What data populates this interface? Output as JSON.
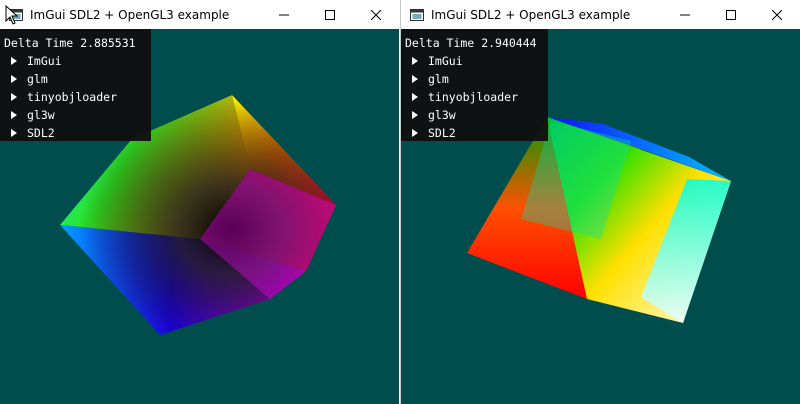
{
  "colors": {
    "background": "#004d4d",
    "titlebar": "#ffffff",
    "imgui_panel": "#0f0f0f"
  },
  "windows": [
    {
      "title": "ImGui SDL2 + OpenGL3 example",
      "caption_icons": [
        "minimize-icon",
        "maximize-icon",
        "close-icon"
      ],
      "panel": {
        "delta_label": "Delta Time",
        "delta_value": "2.885531",
        "nodes": [
          "ImGui",
          "glm",
          "tinyobjloader",
          "gl3w",
          "SDL2"
        ]
      }
    },
    {
      "title": "ImGui SDL2 + OpenGL3 example",
      "caption_icons": [
        "minimize-icon",
        "maximize-icon",
        "close-icon"
      ],
      "panel": {
        "delta_label": "Delta Time",
        "delta_value": "2.940444",
        "nodes": [
          "ImGui",
          "glm",
          "tinyobjloader",
          "gl3w",
          "SDL2"
        ]
      }
    }
  ]
}
